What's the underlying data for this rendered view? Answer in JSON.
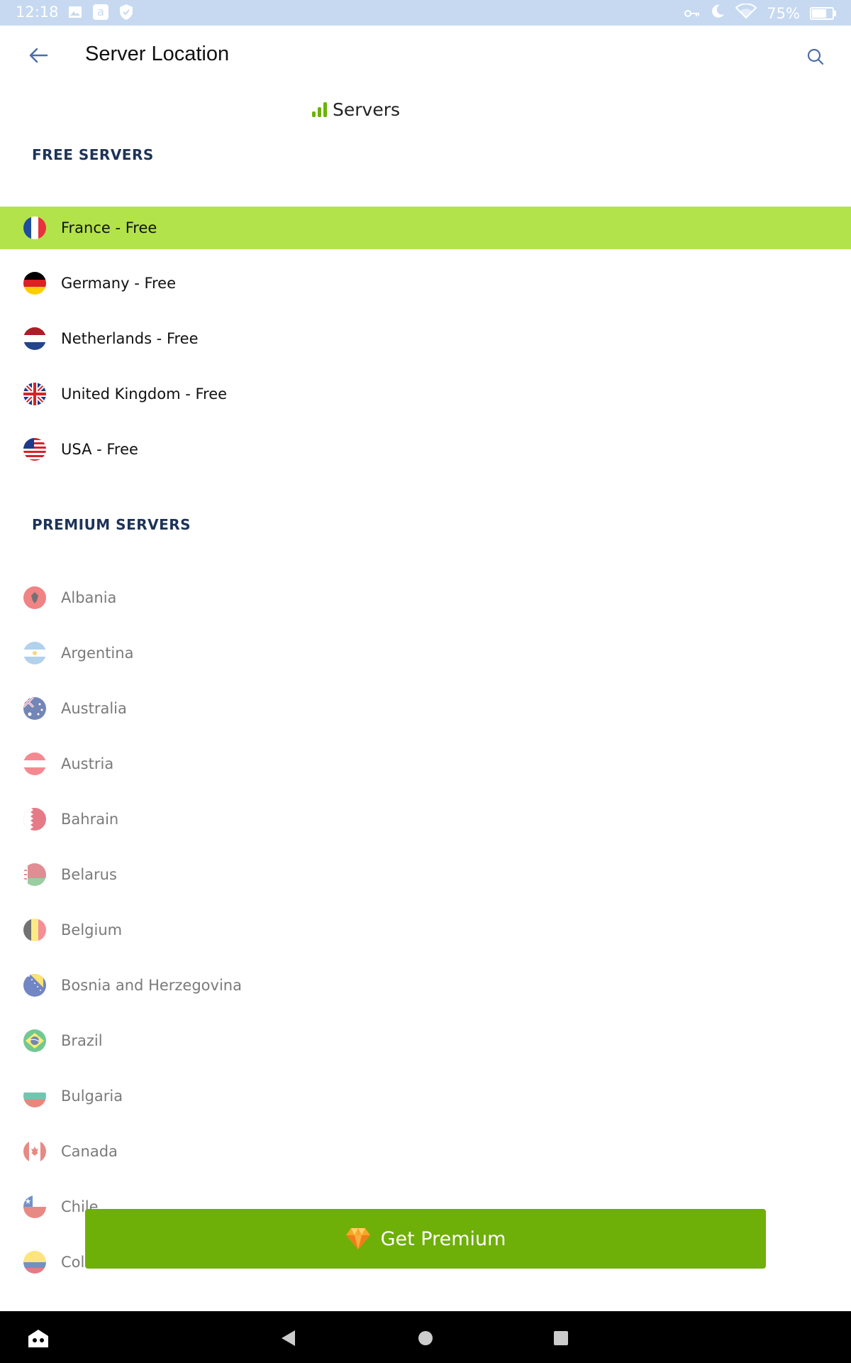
{
  "status_bar": {
    "time": "12:18",
    "battery": "75%",
    "left_icons": [
      "image-icon",
      "amazon-icon",
      "shield-icon"
    ],
    "right_icons": [
      "vpn-key-icon",
      "moon-icon",
      "wifi-icon",
      "battery-icon"
    ]
  },
  "header": {
    "title": "Server Location",
    "back_icon": "arrow-left-icon",
    "search_icon": "search-icon"
  },
  "tab": {
    "label": "Servers",
    "icon": "signal-bars-icon"
  },
  "free_section": {
    "header": "FREE SERVERS",
    "items": [
      {
        "label": "France - Free",
        "flag": "france",
        "selected": true
      },
      {
        "label": "Germany - Free",
        "flag": "germany"
      },
      {
        "label": "Netherlands - Free",
        "flag": "netherlands"
      },
      {
        "label": "United Kingdom - Free",
        "flag": "uk"
      },
      {
        "label": "USA - Free",
        "flag": "usa"
      }
    ]
  },
  "premium_section": {
    "header": "PREMIUM SERVERS",
    "items": [
      {
        "label": "Albania",
        "flag": "albania"
      },
      {
        "label": "Argentina",
        "flag": "argentina"
      },
      {
        "label": "Australia",
        "flag": "australia"
      },
      {
        "label": "Austria",
        "flag": "austria"
      },
      {
        "label": "Bahrain",
        "flag": "bahrain"
      },
      {
        "label": "Belarus",
        "flag": "belarus"
      },
      {
        "label": "Belgium",
        "flag": "belgium"
      },
      {
        "label": "Bosnia and Herzegovina",
        "flag": "bosnia"
      },
      {
        "label": "Brazil",
        "flag": "brazil"
      },
      {
        "label": "Bulgaria",
        "flag": "bulgaria"
      },
      {
        "label": "Canada",
        "flag": "canada"
      },
      {
        "label": "Chile",
        "flag": "chile"
      },
      {
        "label": "Col",
        "flag": "colombia"
      }
    ]
  },
  "cta": {
    "label": "Get Premium",
    "icon": "diamond-icon"
  },
  "nav_bar": {
    "icons": [
      "app-icon",
      "back-triangle-icon",
      "home-circle-icon",
      "recents-square-icon"
    ]
  },
  "colors": {
    "accent_green": "#6eaf08",
    "selected_row": "#b2e34a",
    "status_bar": "#c6d9f1",
    "section_header": "#1d3357"
  }
}
